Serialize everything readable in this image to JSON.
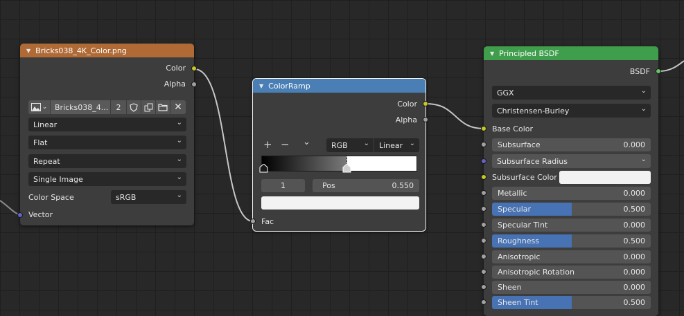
{
  "image_node": {
    "title": "Bricks038_4K_Color.png",
    "outputs": {
      "color": "Color",
      "alpha": "Alpha"
    },
    "image_name": "Bricks038_4...",
    "users_count": "2",
    "interpolation": "Linear",
    "projection": "Flat",
    "extension": "Repeat",
    "source": "Single Image",
    "color_space_label": "Color Space",
    "color_space": "sRGB",
    "input_vector": "Vector",
    "header_color": "#b06a35"
  },
  "colorramp_node": {
    "title": "ColorRamp",
    "outputs": {
      "color": "Color",
      "alpha": "Alpha"
    },
    "add_symbol": "+",
    "remove_symbol": "−",
    "color_mode": "RGB",
    "interpolation": "Linear",
    "stop_index": "1",
    "pos_label": "Pos",
    "pos_value": "0.550",
    "input_fac": "Fac",
    "header_color": "#4a7fb5"
  },
  "bsdf_node": {
    "title": "Principled BSDF",
    "output": "BSDF",
    "distribution": "GGX",
    "subsurface_method": "Christensen-Burley",
    "base_color_label": "Base Color",
    "subsurface_color_label": "Subsurface Color",
    "subsurface_radius_label": "Subsurface Radius",
    "header_color": "#3f9e4c",
    "params": {
      "subsurface": {
        "label": "Subsurface",
        "value": "0.000"
      },
      "metallic": {
        "label": "Metallic",
        "value": "0.000"
      },
      "specular": {
        "label": "Specular",
        "value": "0.500",
        "fraction": 0.5
      },
      "specular_tint": {
        "label": "Specular Tint",
        "value": "0.000"
      },
      "roughness": {
        "label": "Roughness",
        "value": "0.500",
        "fraction": 0.5
      },
      "anisotropic": {
        "label": "Anisotropic",
        "value": "0.000"
      },
      "anisotropic_rotation": {
        "label": "Anisotropic Rotation",
        "value": "0.000"
      },
      "sheen": {
        "label": "Sheen",
        "value": "0.000"
      },
      "sheen_tint": {
        "label": "Sheen Tint",
        "value": "0.500",
        "fraction": 0.5
      }
    }
  }
}
